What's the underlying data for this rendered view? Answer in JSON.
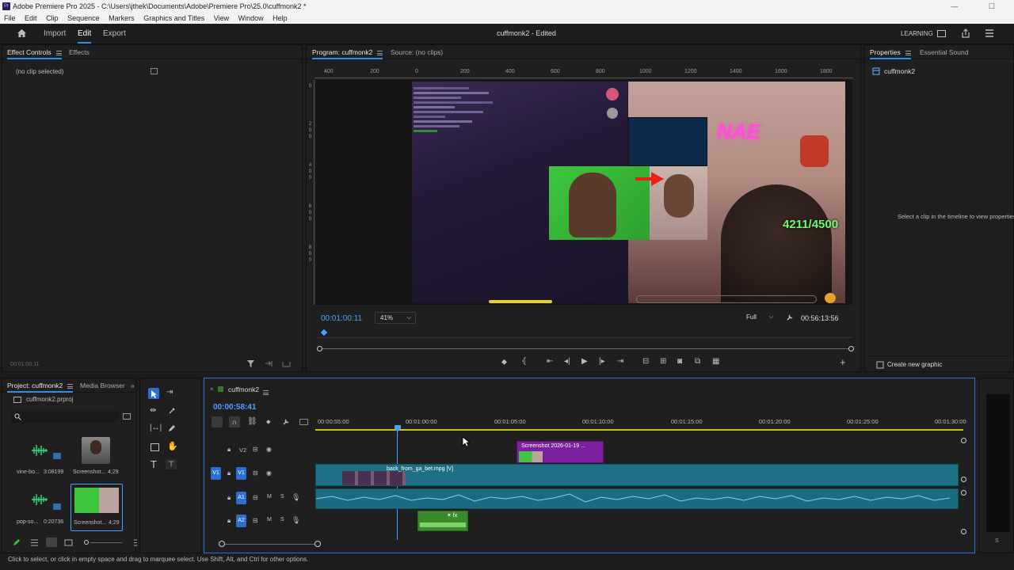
{
  "window": {
    "title": "Adobe Premiere Pro 2025 - C:\\Users\\jthek\\Documents\\Adobe\\Premiere Pro\\25.0\\cuffmonk2 *",
    "logo_text": "Pr"
  },
  "menu": [
    "File",
    "Edit",
    "Clip",
    "Sequence",
    "Markers",
    "Graphics and Titles",
    "View",
    "Window",
    "Help"
  ],
  "header": {
    "nav": [
      "Import",
      "Edit",
      "Export"
    ],
    "active_nav": "Edit",
    "project_title": "cuffmonk2 - Edited",
    "learning_label": "LEARNING"
  },
  "effect_controls": {
    "tabs": [
      "Effect Controls",
      "Effects"
    ],
    "no_clip": "(no clip selected)",
    "timecode": "00:01:00:11"
  },
  "program_monitor": {
    "tab_program": "Program: cuffmonk2",
    "tab_source": "Source: (no clips)",
    "ruler_labels": [
      "400",
      "200",
      "0",
      "200",
      "400",
      "600",
      "800",
      "1000",
      "1200",
      "1400",
      "1600",
      "1800"
    ],
    "vertical_ruler": [
      "0",
      "2",
      "0",
      "0",
      "4",
      "0",
      "0",
      "6",
      "0",
      "0",
      "8",
      "0",
      "0"
    ],
    "current_time": "00:01:00:11",
    "zoom": "41%",
    "resolution": "Full",
    "duration": "00:56:13:56",
    "video_overlay_text": "4211/4500",
    "neon_text": "NAE"
  },
  "properties": {
    "tabs": [
      "Properties",
      "Essential Sound"
    ],
    "sequence_name": "cuffmonk2",
    "hint": "Select a clip in the timeline to view properties",
    "create_graphic": "Create new graphic"
  },
  "project": {
    "tabs": [
      "Project: cuffmonk2",
      "Media Browser"
    ],
    "file": "cuffmonk2.prproj",
    "items": [
      {
        "name": "vine-bo...",
        "duration": "3:08199",
        "type": "audio"
      },
      {
        "name": "Screenshot...",
        "duration": "4;29",
        "type": "image-person"
      },
      {
        "name": "pop-so...",
        "duration": "0:20736",
        "type": "audio"
      },
      {
        "name": "Screenshot...",
        "duration": "4;29",
        "type": "image-reaction"
      }
    ]
  },
  "timeline": {
    "tab": "cuffmonk2",
    "current_time": "00:00:58:41",
    "ruler_labels": [
      "00:00:55:00",
      "00:01:00:00",
      "00:01:05:00",
      "00:01:10:00",
      "00:01:15:00",
      "00:01:20:00",
      "00:01:25:00",
      "00:01:30:00"
    ],
    "tracks": [
      {
        "name": "V2",
        "kind": "video"
      },
      {
        "name": "V1",
        "kind": "video",
        "source": "V1"
      },
      {
        "name": "A1",
        "kind": "audio",
        "source": "A1"
      },
      {
        "name": "A2",
        "kind": "audio"
      }
    ],
    "clips": {
      "v2_clip": "Screenshot 2026-01-19 ...",
      "v1_clip": "back_from_ga_bet.mpg [V]"
    },
    "track_buttons": {
      "mute": "M",
      "solo": "S"
    }
  },
  "status": "Click to select, or click in empty space and drag to marquee select. Use Shift, Alt, and Ctrl for other options.",
  "colors": {
    "accent": "#2d8ceb",
    "v1_clip": "#1d6f85",
    "v2_clip": "#7a1f9e",
    "audio_clip": "#1a6a80",
    "a2_clip": "#3b8a2a",
    "playhead": "#4aa0ff",
    "work_area": "#d4d400"
  }
}
